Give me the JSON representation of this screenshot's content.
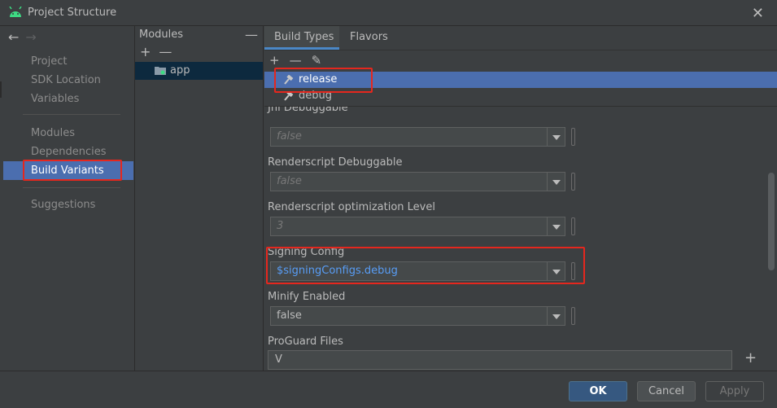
{
  "window": {
    "title": "Project Structure"
  },
  "sidebar": {
    "items_group1": [
      "Project",
      "SDK Location",
      "Variables"
    ],
    "items_group2": [
      "Modules",
      "Dependencies",
      "Build Variants"
    ],
    "items_group3": [
      "Suggestions"
    ],
    "selected": "Build Variants"
  },
  "modules": {
    "header": "Modules",
    "items": [
      "app"
    ]
  },
  "build_variants": {
    "tabs": [
      "Build Types",
      "Flavors"
    ],
    "active_tab": "Build Types",
    "build_types": [
      "release",
      "debug"
    ],
    "selected_build_type": "release"
  },
  "properties": [
    {
      "label": "Jni Debuggable",
      "value": "false",
      "style": "placeholder"
    },
    {
      "label": "Renderscript Debuggable",
      "value": "false",
      "style": "placeholder"
    },
    {
      "label": "Renderscript optimization Level",
      "value": "3",
      "style": "placeholder"
    },
    {
      "label": "Signing Config",
      "value": "$signingConfigs.debug",
      "style": "link"
    },
    {
      "label": "Minify Enabled",
      "value": "false",
      "style": "normal"
    }
  ],
  "proguard": {
    "label": "ProGuard Files",
    "value": "V"
  },
  "footer": {
    "ok": "OK",
    "cancel": "Cancel",
    "apply": "Apply"
  },
  "colors": {
    "accent": "#4b6eaf",
    "highlight": "#e5271e",
    "link": "#589df6"
  }
}
